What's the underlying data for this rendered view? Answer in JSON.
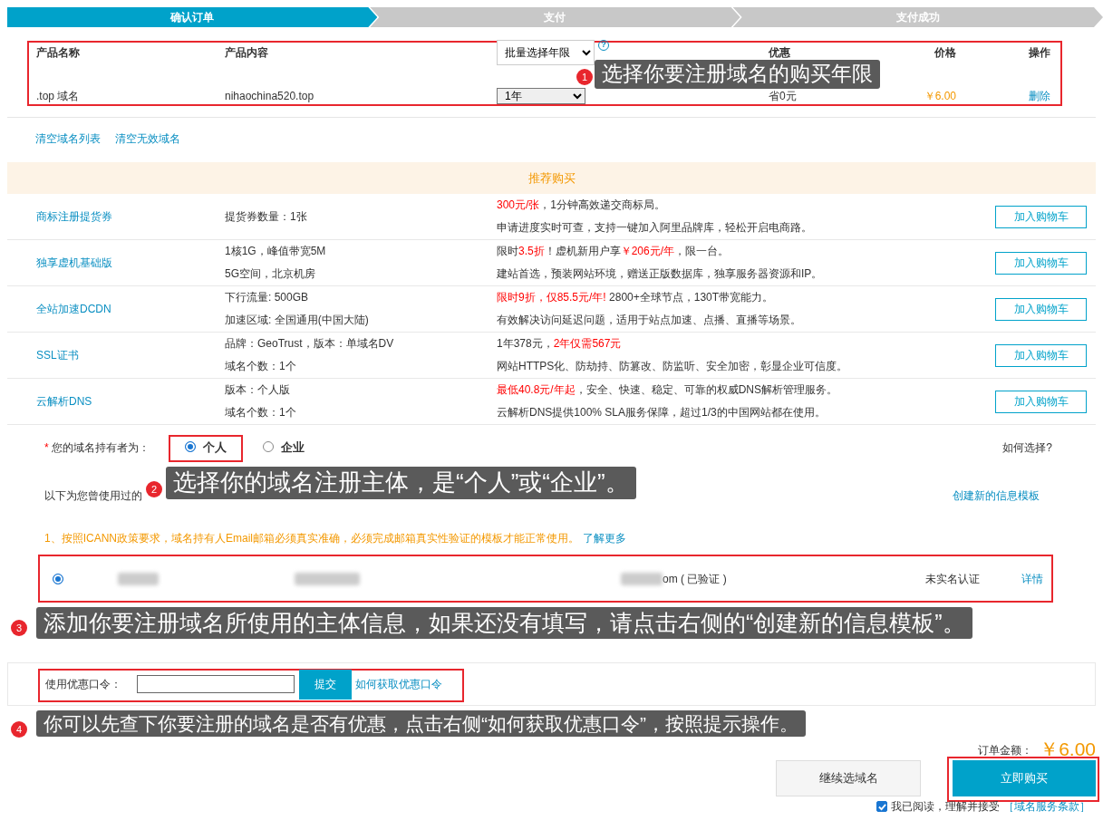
{
  "steps": [
    {
      "label": "确认订单",
      "selected": true
    },
    {
      "label": "支付",
      "selected": false
    },
    {
      "label": "支付成功",
      "selected": false
    }
  ],
  "order_table": {
    "columns": [
      "产品名称",
      "产品内容",
      "优惠",
      "价格",
      "操作"
    ],
    "bulk_select": "批量选择年限",
    "help_icon": "?",
    "rows": [
      {
        "product": ".top 域名",
        "content": "nihaochina520.top",
        "term": "1年",
        "saving": "省0元",
        "price": "￥6.00",
        "action": "删除"
      }
    ]
  },
  "list_links": [
    "清空域名列表",
    "清空无效域名"
  ],
  "recommend": {
    "title": "推荐购买",
    "items": [
      {
        "name": "商标注册提货券",
        "button": "加入购物车",
        "spec": [
          "提货券数量：1张"
        ],
        "desc": [
          [
            {
              "text": "300元/张",
              "red": true
            },
            {
              "text": "，1分钟高效递交商标局。",
              "red": false
            }
          ],
          [
            {
              "text": "申请进度实时可查，支持一键加入阿里品牌库，轻松开启电商路。",
              "red": false
            }
          ]
        ]
      },
      {
        "name": "独享虚机基础版",
        "button": "加入购物车",
        "spec": [
          "1核1G，峰值带宽5M",
          "5G空间，北京机房"
        ],
        "desc": [
          [
            {
              "text": "限时",
              "red": false
            },
            {
              "text": "3.5折",
              "red": true
            },
            {
              "text": "！虚机新用户享",
              "red": false
            },
            {
              "text": "￥206元/年",
              "red": true
            },
            {
              "text": "，限一台。",
              "red": false
            }
          ],
          [
            {
              "text": "建站首选，预装网站环境，赠送正版数据库，独享服务器资源和IP。",
              "red": false
            }
          ]
        ]
      },
      {
        "name": "全站加速DCDN",
        "button": "加入购物车",
        "spec": [
          "下行流量: 500GB",
          "加速区域: 全国通用(中国大陆)"
        ],
        "desc": [
          [
            {
              "text": "限时9折，仅85.5元/年!",
              "red": true
            },
            {
              "text": " 2800+全球节点，130T带宽能力。",
              "red": false
            }
          ],
          [
            {
              "text": "有效解决访问延迟问题，适用于站点加速、点播、直播等场景。",
              "red": false
            }
          ]
        ]
      },
      {
        "name": "SSL证书",
        "button": "加入购物车",
        "spec": [
          "品牌：GeoTrust，版本：单域名DV",
          "域名个数：1个"
        ],
        "desc": [
          [
            {
              "text": "1年378元，",
              "red": false
            },
            {
              "text": "2年仅需567元",
              "red": true
            }
          ],
          [
            {
              "text": "网站HTTPS化、防劫持、防篡改、防监听、安全加密，彰显企业可信度。",
              "red": false
            }
          ]
        ]
      },
      {
        "name": "云解析DNS",
        "button": "加入购物车",
        "spec": [
          "版本：个人版",
          "域名个数：1个"
        ],
        "desc": [
          [
            {
              "text": "最低40.8元/年起",
              "red": true
            },
            {
              "text": "，安全、快速、稳定、可靠的权威DNS解析管理服务。",
              "red": false
            }
          ],
          [
            {
              "text": "云解析DNS提供100% SLA服务保障，超过1/3的中国网站都在使用。",
              "red": false
            }
          ]
        ]
      }
    ]
  },
  "holder": {
    "required_mark": "*",
    "label": "您的域名持有者为：",
    "help": "如何选择?",
    "options": [
      {
        "label": "个人",
        "selected": true
      },
      {
        "label": "企业",
        "selected": false
      }
    ]
  },
  "templates": {
    "intro": "以下为您曾使用过的",
    "create_link": "创建新的信息模板",
    "notice": "1、按照ICANN政策要求，域名持有人Email邮箱必须真实准确，必须完成邮箱真实性验证的模板才能正常使用。",
    "notice_link": "了解更多",
    "rows": [
      {
        "selected": true,
        "email_tail": "om ( 已验证 )",
        "status": "未实名认证",
        "action": "详情"
      }
    ]
  },
  "coupon": {
    "label": "使用优惠口令：",
    "submit": "提交",
    "link": "如何获取优惠口令"
  },
  "total": {
    "label": "订单金额：",
    "amount": "￥6.00"
  },
  "buttons": {
    "continue": "继续选域名",
    "buy": "立即购买"
  },
  "agreement": {
    "checked": true,
    "text": "我已阅读，理解并接受",
    "link": "［域名服务条款］"
  },
  "annotations": [
    {
      "number": "1",
      "text": "选择你要注册域名的购买年限"
    },
    {
      "number": "2",
      "text": "选择你的域名注册主体，是“个人”或“企业”。"
    },
    {
      "number": "3",
      "text": "添加你要注册域名所使用的主体信息，如果还没有填写，请点击右侧的“创建新的信息模板”。"
    },
    {
      "number": "4",
      "text": "你可以先查下你要注册的域名是否有优惠，点击右侧“如何获取优惠口令”，按照提示操作。"
    }
  ]
}
